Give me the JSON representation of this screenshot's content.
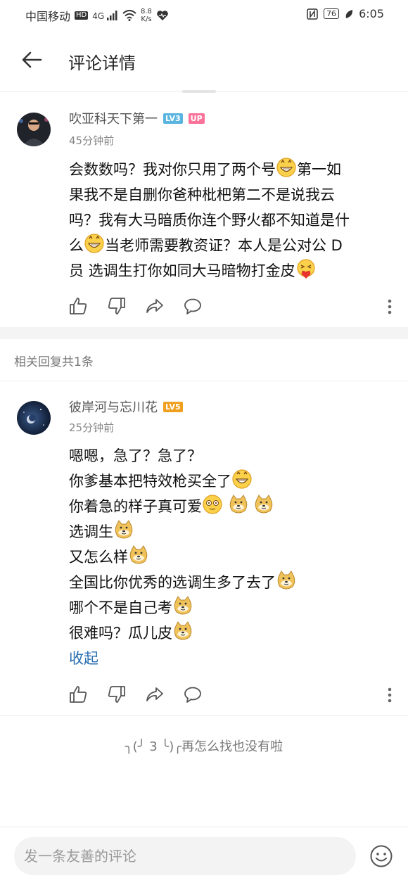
{
  "status_bar": {
    "carrier": "中国移动",
    "hd": "HD",
    "network": "4G",
    "speed_top": "8.8",
    "speed_bottom": "K/s",
    "battery": "76",
    "time": "6:05"
  },
  "app_bar": {
    "title": "评论详情"
  },
  "main_comment": {
    "username": "吹亚科天下第一",
    "level": "LV3",
    "up_badge": "UP",
    "time": "45分钟前",
    "lines": [
      "会数数吗？我对你只用了两个号",
      "第一如",
      "果我不是自删你爸种枇杷第二不是说我云",
      "吗？我有大马暗质你连个野火都不知道是什",
      "么",
      "当老师需要教资证？本人是公对公 D",
      "员 选调生打你如同大马暗物打金皮"
    ]
  },
  "related_label": "相关回复共1条",
  "reply": {
    "username": "彼岸河与忘川花",
    "level": "LV5",
    "time": "25分钟前",
    "lines": [
      "嗯嗯，急了？急了？",
      "你爹基本把特效枪买全了",
      "你着急的样子真可爱",
      "选调生",
      "又怎么样",
      "全国比你优秀的选调生多了去了",
      "哪个不是自己考",
      "很难吗？瓜儿皮"
    ],
    "collapse": "收起"
  },
  "end_text": "╮(╯ 3 ╰)╭再怎么找也没有啦",
  "bottom_bar": {
    "placeholder": "发一条友善的评论"
  },
  "colors": {
    "accent_link": "#2a6fb0",
    "level3": "#5ab4e0",
    "level5": "#f0a020",
    "up_badge": "#fb7299"
  },
  "icons": [
    "back-arrow-icon",
    "like-icon",
    "dislike-icon",
    "share-icon",
    "comment-icon",
    "more-icon",
    "grin-emoji-icon",
    "doge-emoji-icon",
    "dizzy-emoji-icon",
    "laugh-heart-emoji-icon",
    "smiley-icon"
  ]
}
